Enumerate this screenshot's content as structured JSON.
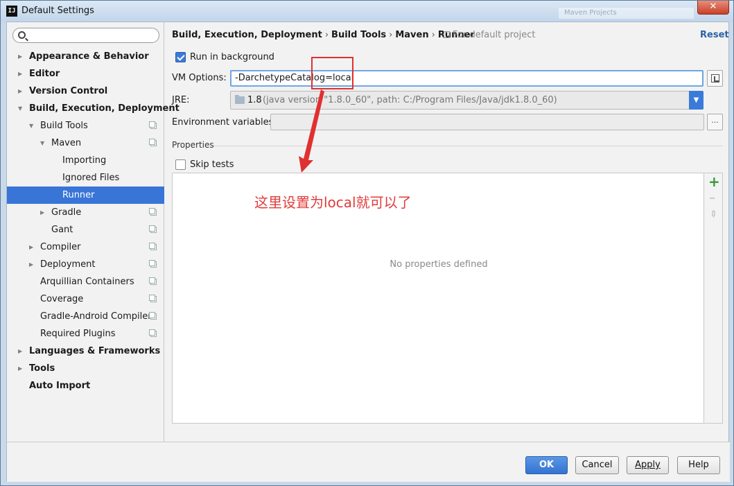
{
  "window": {
    "title": "Default Settings",
    "app_icon": "IJ",
    "background_title": "Maven Projects",
    "close_label": "✕"
  },
  "sidebar": {
    "search_value": "",
    "items": [
      {
        "label": "Appearance & Behavior",
        "bold": true,
        "arrow": "right",
        "level": 0
      },
      {
        "label": "Editor",
        "bold": true,
        "arrow": "right",
        "level": 0
      },
      {
        "label": "Version Control",
        "bold": true,
        "arrow": "right",
        "level": 0
      },
      {
        "label": "Build, Execution, Deployment",
        "bold": true,
        "arrow": "down",
        "level": 0
      },
      {
        "label": "Build Tools",
        "arrow": "down",
        "level": 1,
        "copy": true
      },
      {
        "label": "Maven",
        "arrow": "down",
        "level": 2,
        "copy": true
      },
      {
        "label": "Importing",
        "level": 3
      },
      {
        "label": "Ignored Files",
        "level": 3
      },
      {
        "label": "Runner",
        "level": 3,
        "selected": true
      },
      {
        "label": "Gradle",
        "arrow": "right",
        "level": 2,
        "copy": true
      },
      {
        "label": "Gant",
        "level": 2,
        "copy": true
      },
      {
        "label": "Compiler",
        "arrow": "right",
        "level": 1,
        "copy": true
      },
      {
        "label": "Deployment",
        "arrow": "right",
        "level": 1,
        "copy": true
      },
      {
        "label": "Arquillian Containers",
        "level": 1,
        "copy": true
      },
      {
        "label": "Coverage",
        "level": 1,
        "copy": true
      },
      {
        "label": "Gradle-Android Compiler",
        "level": 1,
        "copy": true
      },
      {
        "label": "Required Plugins",
        "level": 1,
        "copy": true
      },
      {
        "label": "Languages & Frameworks",
        "bold": true,
        "arrow": "right",
        "level": 0
      },
      {
        "label": "Tools",
        "bold": true,
        "arrow": "right",
        "level": 0
      },
      {
        "label": "Auto Import",
        "bold": true,
        "level": 0
      }
    ]
  },
  "breadcrumb": {
    "items": [
      "Build, Execution, Deployment",
      "Build Tools",
      "Maven",
      "Runner"
    ],
    "separator": "›",
    "scope": "For default project"
  },
  "reset_label": "Reset",
  "run_in_background": {
    "label": "Run in background",
    "checked": true
  },
  "vm_options": {
    "label": "VM Options:",
    "value": "-DarchetypeCatalog=local"
  },
  "jre": {
    "label": "JRE:",
    "version": "1.8",
    "detail": "(java version \"1.8.0_60\", path: C:/Program Files/Java/jdk1.8.0_60)"
  },
  "env_vars": {
    "label": "Environment variables:",
    "value": "",
    "browse_label": "..."
  },
  "properties": {
    "title": "Properties",
    "skip_tests": {
      "label": "Skip tests",
      "checked": false
    },
    "empty_text": "No properties defined"
  },
  "annotation": "这里设置为local就可以了",
  "footer": {
    "ok": "OK",
    "cancel": "Cancel",
    "apply": "Apply",
    "help": "Help"
  },
  "colors": {
    "selection": "#3875d7",
    "annotation": "#e23b3b",
    "primary_button": "#3b7bd8",
    "link": "#2a62a6"
  },
  "icons": [
    "search-icon",
    "gear-icon",
    "copy-icon",
    "folder-icon",
    "expand-icon",
    "add-icon",
    "remove-icon",
    "edit-icon"
  ]
}
